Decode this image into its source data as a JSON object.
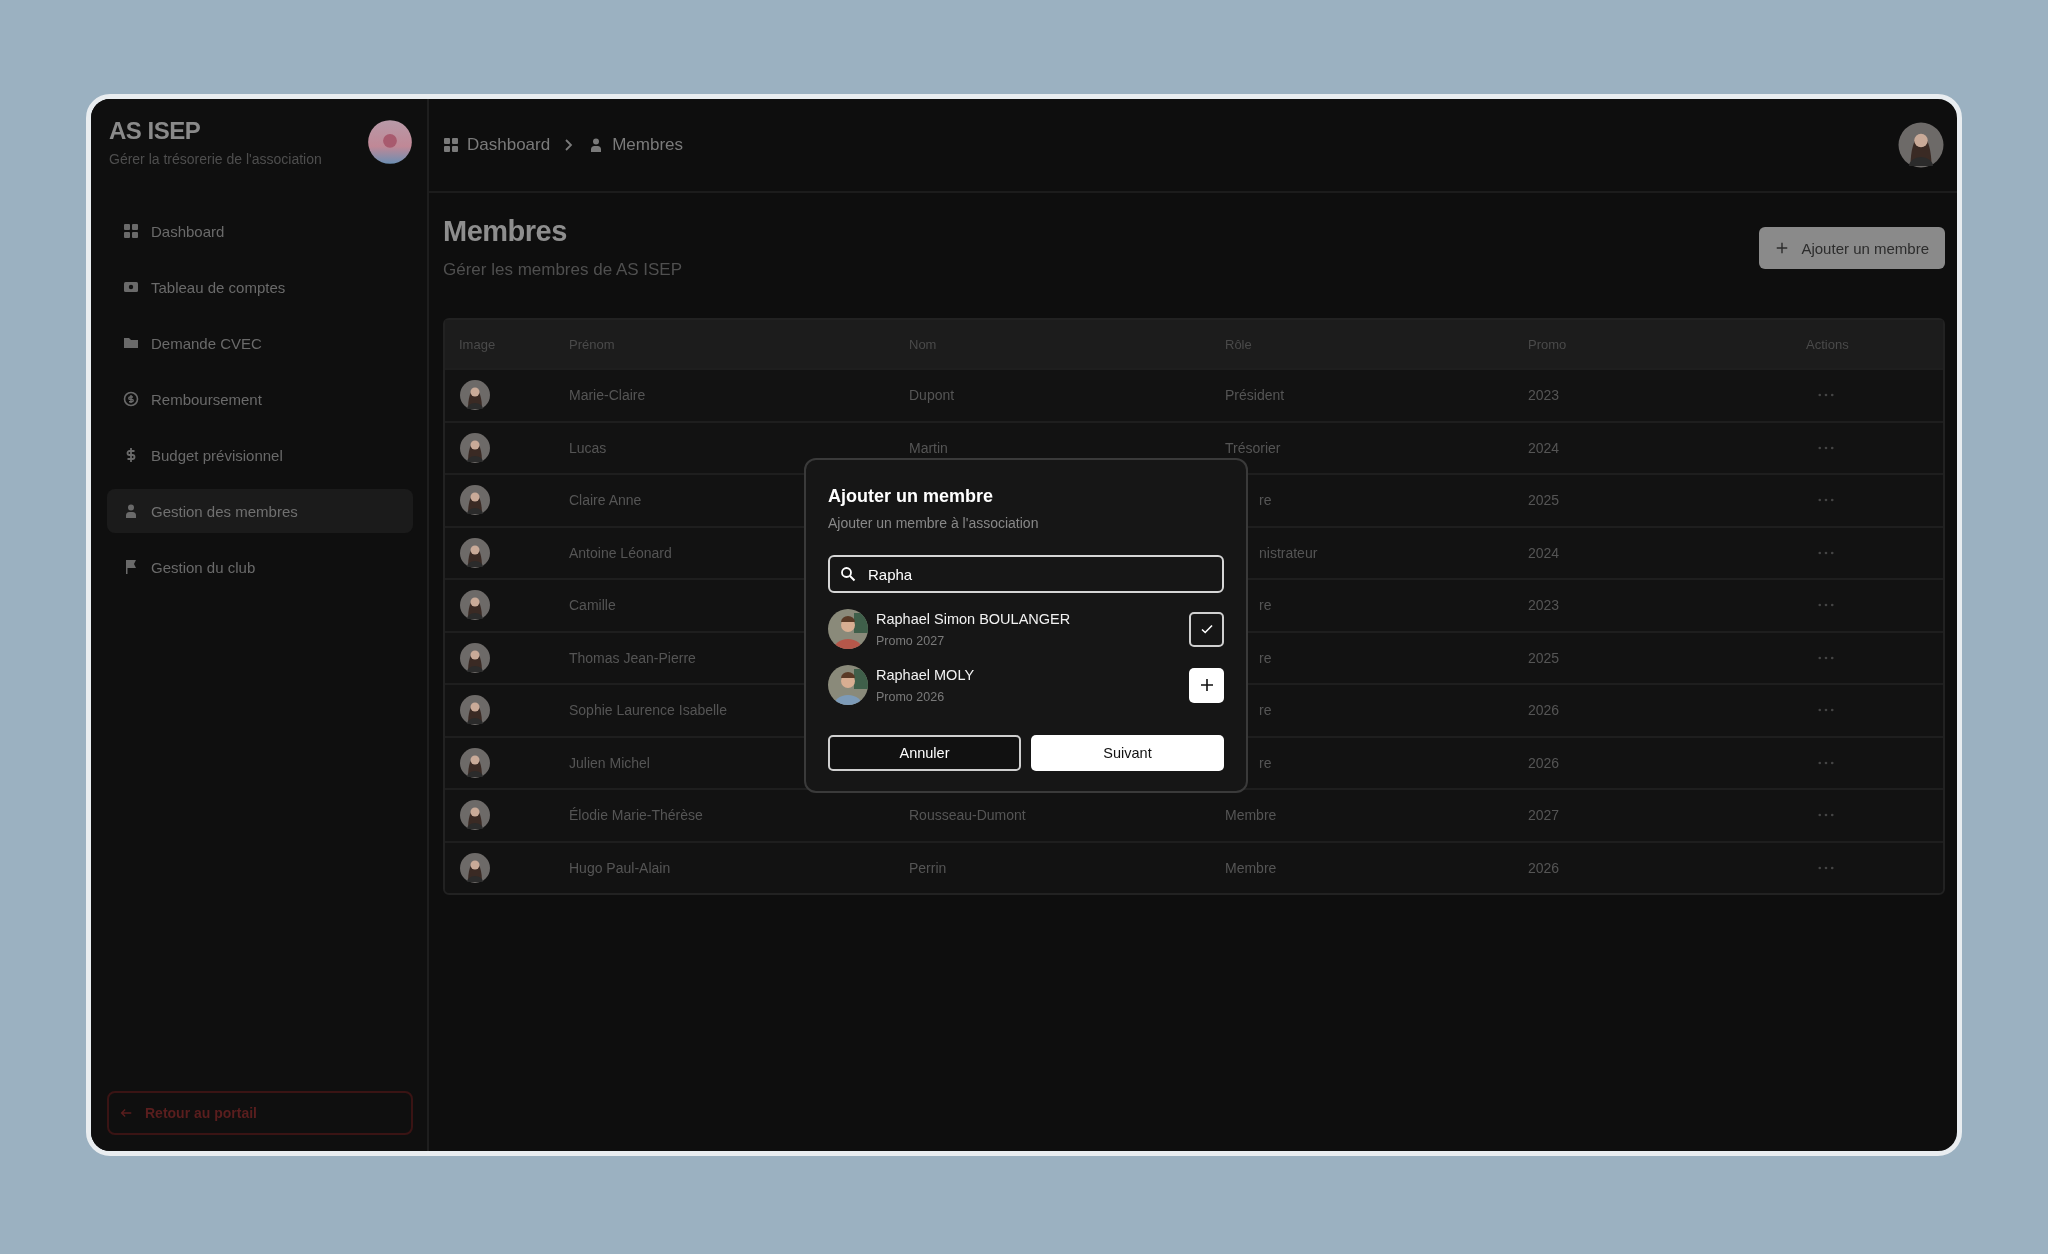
{
  "sidebar": {
    "title": "AS ISEP",
    "subtitle": "Gérer la trésorerie de l'association",
    "items": [
      {
        "label": "Dashboard",
        "selected": false
      },
      {
        "label": "Tableau de comptes",
        "selected": false
      },
      {
        "label": "Demande CVEC",
        "selected": false
      },
      {
        "label": "Remboursement",
        "selected": false
      },
      {
        "label": "Budget prévisionnel",
        "selected": false
      },
      {
        "label": "Gestion des membres",
        "selected": true
      },
      {
        "label": "Gestion du club",
        "selected": false
      }
    ],
    "back_button": "Retour au portail"
  },
  "breadcrumb": [
    {
      "label": "Dashboard"
    },
    {
      "label": "Membres"
    }
  ],
  "page": {
    "title": "Membres",
    "subtitle": "Gérer les membres de AS ISEP",
    "add_button": "Ajouter un membre"
  },
  "table": {
    "columns": [
      "Image",
      "Prénom",
      "Nom",
      "Rôle",
      "Promo",
      "Actions"
    ],
    "rows": [
      {
        "prenom": "Marie-Claire",
        "nom": "Dupont",
        "role": "Président",
        "promo": "2023",
        "role_clipped": false
      },
      {
        "prenom": "Lucas",
        "nom": "Martin",
        "role": "Trésorier",
        "promo": "2024",
        "role_clipped": false
      },
      {
        "prenom": "Claire Anne",
        "role": "re",
        "promo": "2025",
        "role_clipped": true
      },
      {
        "prenom": "Antoine Léonard",
        "role": "nistrateur",
        "promo": "2024",
        "role_clipped": true
      },
      {
        "prenom": "Camille",
        "role": "re",
        "promo": "2023",
        "role_clipped": true
      },
      {
        "prenom": "Thomas Jean-Pierre",
        "role": "re",
        "promo": "2025",
        "role_clipped": true
      },
      {
        "prenom": "Sophie Laurence Isabelle",
        "role": "re",
        "promo": "2026",
        "role_clipped": true
      },
      {
        "prenom": "Julien Michel",
        "role": "re",
        "promo": "2026",
        "role_clipped": true
      },
      {
        "prenom": "Élodie Marie-Thérèse",
        "nom": "Rousseau-Dumont",
        "role": "Membre",
        "promo": "2027",
        "role_clipped": false
      },
      {
        "prenom": "Hugo Paul-Alain",
        "nom": "Perrin",
        "role": "Membre",
        "promo": "2026",
        "role_clipped": false
      }
    ]
  },
  "dialog": {
    "title": "Ajouter un membre",
    "subtitle": "Ajouter un membre à l'association",
    "search": {
      "value": "Rapha"
    },
    "results": [
      {
        "name": "Raphael Simon BOULANGER",
        "promo": "Promo 2027",
        "selected": true
      },
      {
        "name": "Raphael MOLY",
        "promo": "Promo 2026",
        "selected": false
      }
    ],
    "cancel_button": "Annuler",
    "next_button": "Suivant"
  }
}
